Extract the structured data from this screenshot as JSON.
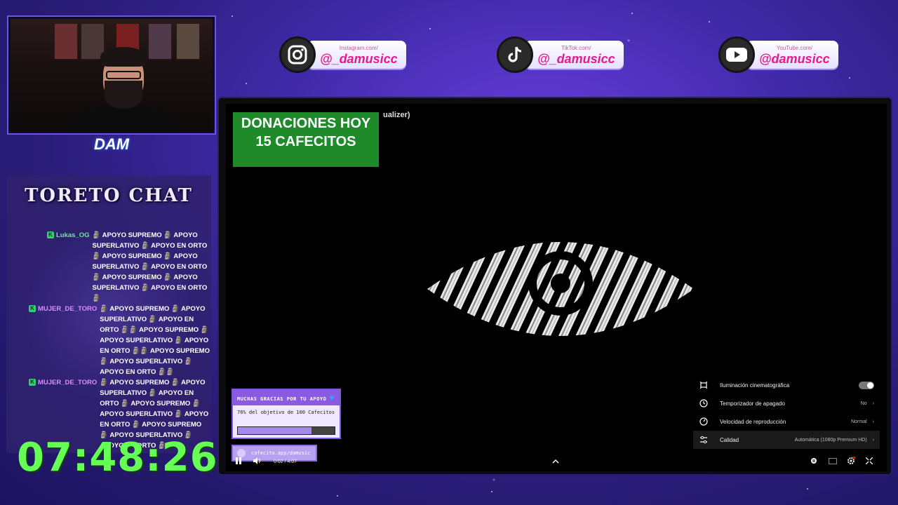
{
  "socials": [
    {
      "network": "instagram",
      "icon": "instagram-icon",
      "url": "Instagram.com/",
      "handle": "@_damusicc"
    },
    {
      "network": "tiktok",
      "icon": "tiktok-icon",
      "url": "TikTok.com/",
      "handle": "@_damusicc"
    },
    {
      "network": "youtube",
      "icon": "youtube-icon",
      "url": "YouTube.com/",
      "handle": "@damusicc"
    }
  ],
  "webcam": {
    "logo_text": "DAM"
  },
  "chat": {
    "title": "TORETO CHAT",
    "messages": [
      {
        "user": "Lukas_OG",
        "text": "🗿 APOYO SUPREMO 🗿 APOYO SUPERLATIVO 🗿 APOYO EN ORTO 🗿 APOYO SUPREMO 🗿 APOYO SUPERLATIVO 🗿 APOYO EN ORTO 🗿 APOYO SUPREMO 🗿 APOYO SUPERLATIVO 🗿 APOYO EN ORTO 🗿"
      },
      {
        "user": "MUJER_DE_TORO",
        "text": "🗿 APOYO SUPREMO 🗿 APOYO SUPERLATIVO 🗿 APOYO EN ORTO 🗿🗿 APOYO SUPREMO 🗿 APOYO SUPERLATIVO 🗿 APOYO EN ORTO 🗿🗿 APOYO SUPREMO 🗿 APOYO SUPERLATIVO 🗿 APOYO EN ORTO 🗿🗿"
      },
      {
        "user": "MUJER_DE_TORO",
        "text": "🗿 APOYO SUPREMO 🗿 APOYO SUPERLATIVO 🗿 APOYO EN ORTO 🗿 APOYO SUPREMO 🗿 APOYO SUPERLATIVO 🗿 APOYO EN ORTO 🗿 APOYO SUPREMO 🗿 APOYO SUPERLATIVO 🗿 APOYO EN ORTO 🗿"
      }
    ]
  },
  "timer": "07:48:26",
  "video": {
    "title_fragment": "ualizer)",
    "donations": {
      "line1": "DONACIONES HOY",
      "line2": "15 CAFECITOS"
    },
    "settings": [
      {
        "icon": "cinematic-icon",
        "label": "Iluminación cinematográfica",
        "value": "",
        "toggle": true
      },
      {
        "icon": "timer-icon",
        "label": "Temporizador de apagado",
        "value": "No"
      },
      {
        "icon": "speed-icon",
        "label": "Velocidad de reproducción",
        "value": "Normal"
      },
      {
        "icon": "sliders-icon",
        "label": "Calidad",
        "value": "Automática (1080p Premium HD)"
      }
    ],
    "support": {
      "header": "MUCHAS GRACIAS POR TU APOYO",
      "goal_text": "76% del objetivo de 100 Cafecitos",
      "progress": 0.76,
      "link": "cafecito.app/damusic"
    },
    "time": "0:02 / 4:07"
  },
  "colors": {
    "timer": "#66ff55",
    "donations_bg": "#1e8a2a",
    "accent": "#8a5ae0"
  }
}
